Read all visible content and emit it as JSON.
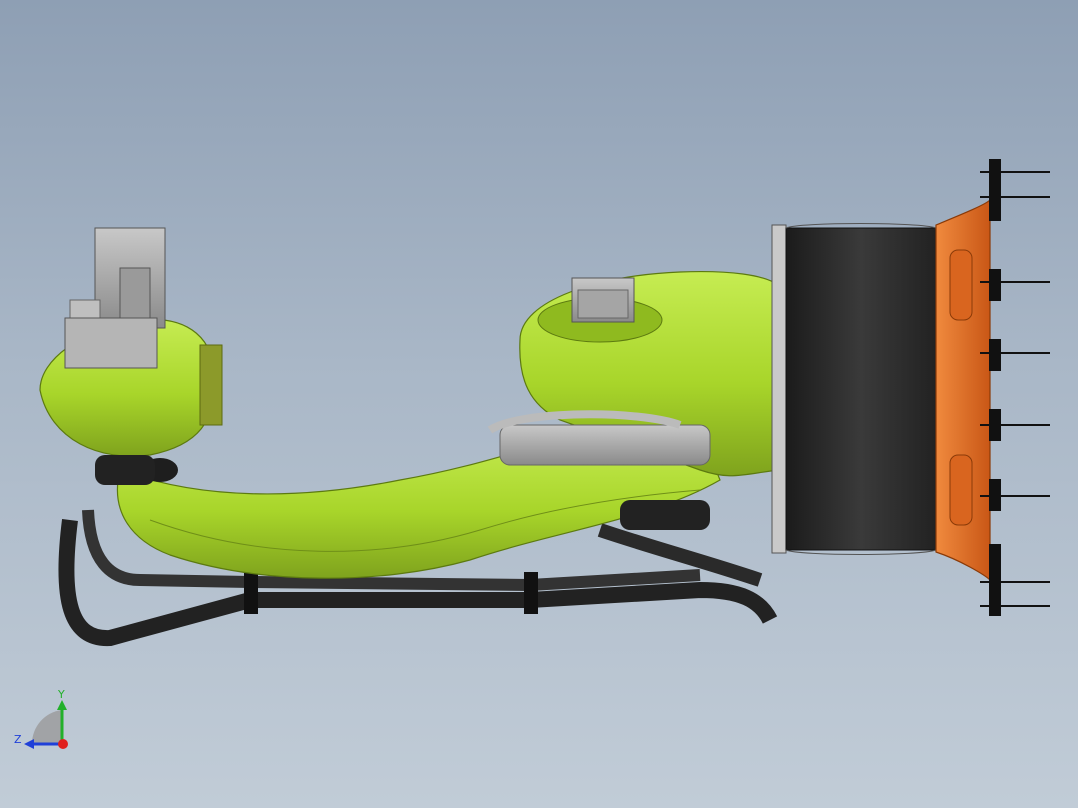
{
  "viewport": {
    "background_top": "#8e9fb4",
    "background_bottom": "#c1ccd7"
  },
  "model": {
    "body_color": "#a8d52a",
    "body_shadow": "#7fa31d",
    "hose_color": "#2a2a2a",
    "housing_color": "#2b2b2b",
    "flange_color": "#e8702a",
    "hardware_color": "#9a9a9a"
  },
  "triad": {
    "y_label": "Y",
    "z_label": "Z",
    "x_color": "#e0201e",
    "y_color": "#22b02a",
    "z_color": "#2040d8"
  }
}
